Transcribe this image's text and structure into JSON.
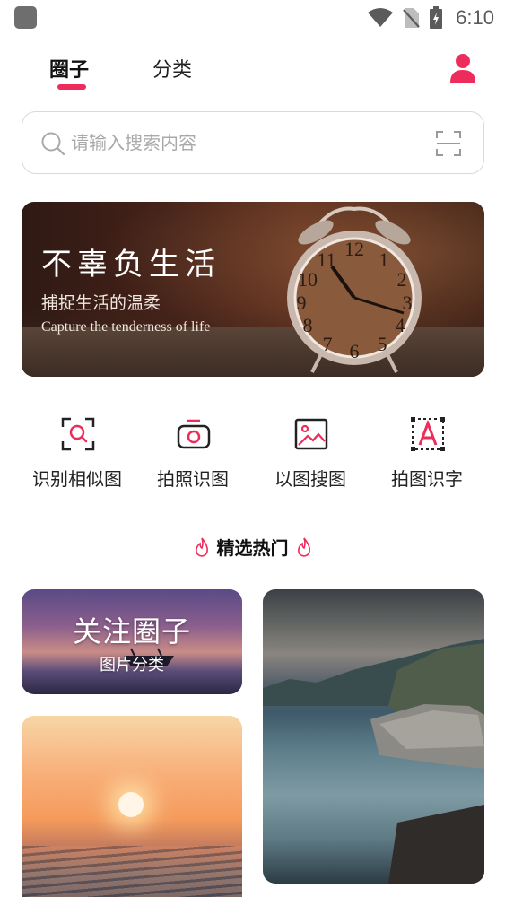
{
  "status_bar": {
    "time": "6:10",
    "icons": [
      "app-notification-icon",
      "wifi-icon",
      "no-sim-icon",
      "battery-icon"
    ]
  },
  "header": {
    "tabs": [
      {
        "label": "圈子",
        "active": true
      },
      {
        "label": "分类",
        "active": false
      }
    ],
    "profile_icon": "user-profile-icon",
    "accent_color": "#ee2c5b"
  },
  "search": {
    "placeholder": "请输入搜索内容",
    "value": "",
    "icon": "search-icon",
    "scan_icon": "scan-icon"
  },
  "banner": {
    "title": "不辜负生活",
    "subtitle": "捕捉生活的温柔",
    "subtitle_en": "Capture the tenderness of life"
  },
  "tools": [
    {
      "label": "识别相似图",
      "icon": "scan-search-icon"
    },
    {
      "label": "拍照识图",
      "icon": "camera-icon"
    },
    {
      "label": "以图搜图",
      "icon": "image-icon"
    },
    {
      "label": "拍图识字",
      "icon": "text-recognition-icon"
    }
  ],
  "section": {
    "title": "精选热门",
    "icon": "flame-icon"
  },
  "cards": [
    {
      "title": "关注圈子",
      "subtitle": "图片分类"
    }
  ]
}
